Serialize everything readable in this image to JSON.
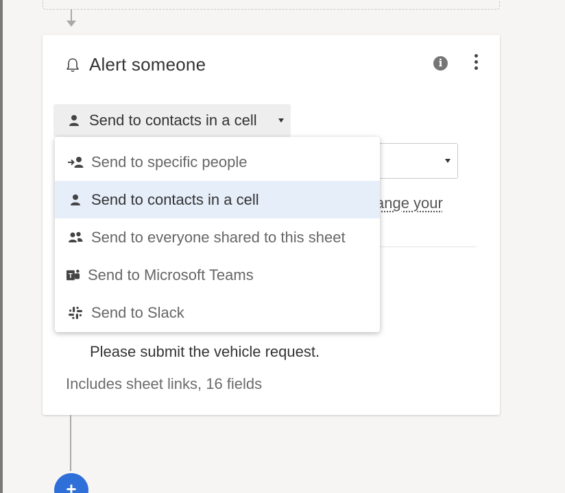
{
  "workflow": {
    "action_card": {
      "title": "Alert someone",
      "recipient_select": {
        "selected": "Send to contacts in a cell"
      },
      "change_link_text": "ange your",
      "message_line": "Please submit the vehicle request.",
      "includes_text": "Includes sheet links, 16 fields"
    },
    "add_button_label": "+"
  },
  "dropdown": {
    "items": [
      {
        "label": "Send to specific people",
        "icon": "add-person-icon",
        "selected": false
      },
      {
        "label": "Send to contacts in a cell",
        "icon": "person-icon",
        "selected": true
      },
      {
        "label": "Send to everyone shared to this sheet",
        "icon": "people-icon",
        "selected": false
      },
      {
        "label": "Send to Microsoft Teams",
        "icon": "microsoft-teams-icon",
        "selected": false
      },
      {
        "label": "Send to Slack",
        "icon": "slack-icon",
        "selected": false
      }
    ]
  },
  "colors": {
    "accent": "#2f6fd8",
    "selected_item_bg": "#e6eef9",
    "page_bg": "#f6f5f3"
  }
}
